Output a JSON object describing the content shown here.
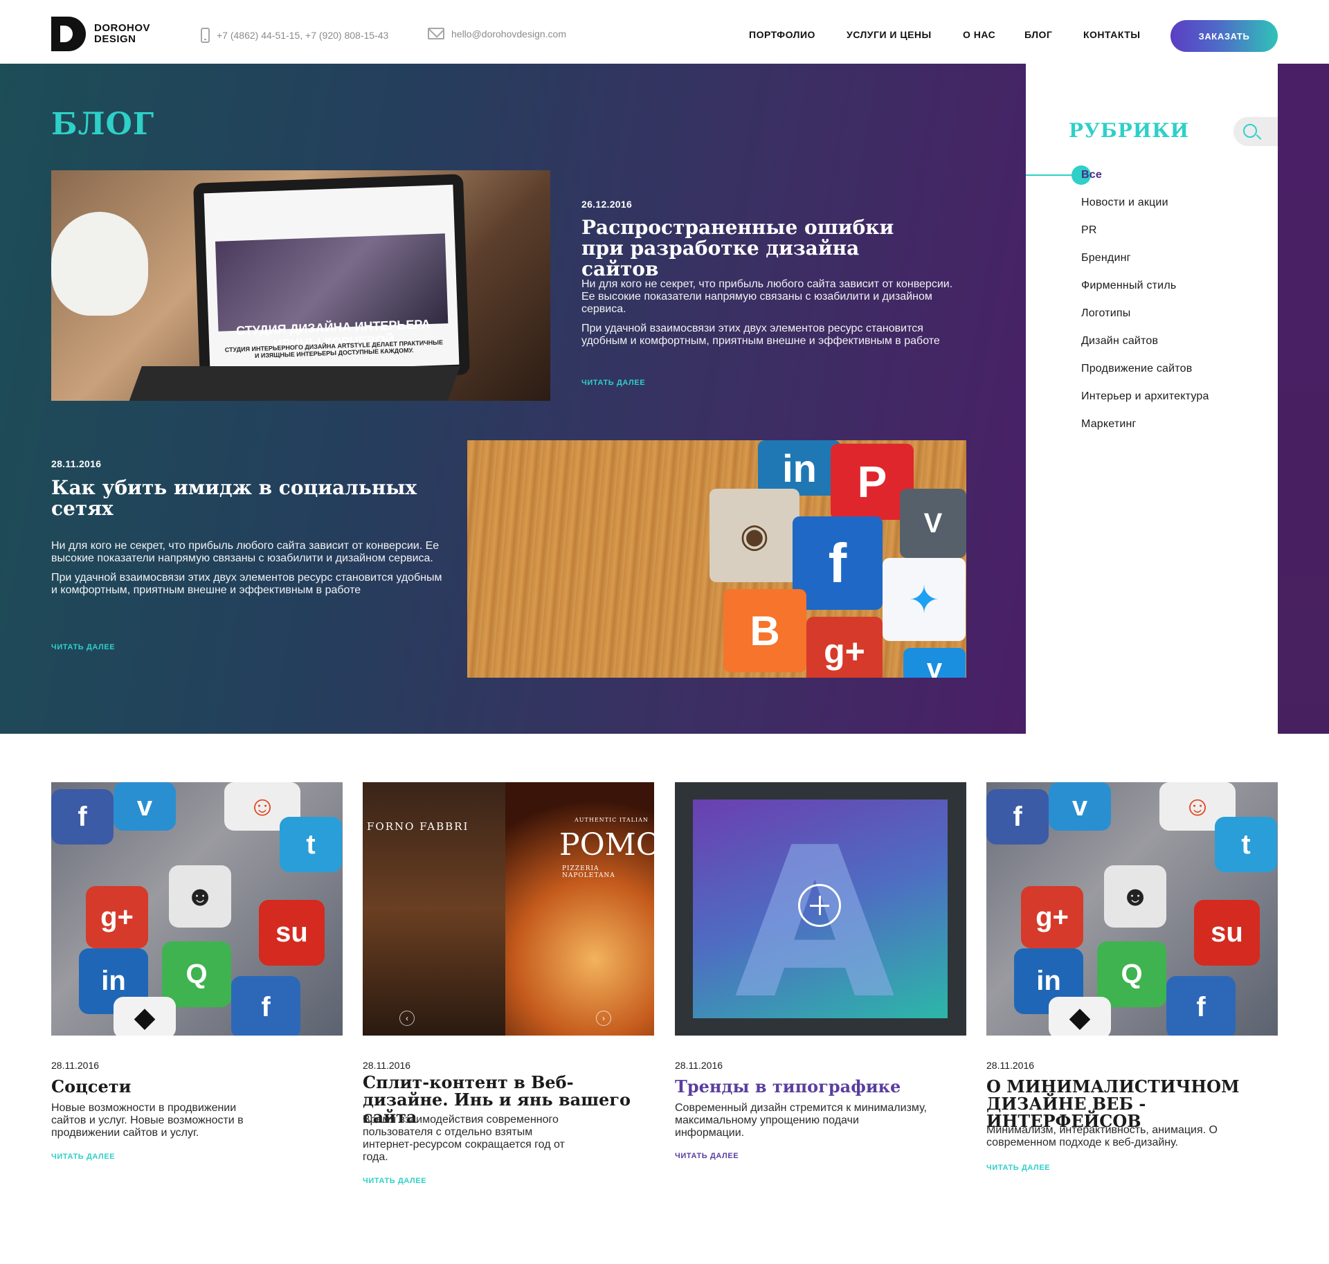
{
  "header": {
    "logo_line1": "DOROHOV",
    "logo_line2": "DESIGN",
    "phones": "+7 (4862) 44-51-15,  +7 (920) 808-15-43",
    "email": "hello@dorohovdesign.com",
    "nav": [
      "ПОРТФОЛИО",
      "УСЛУГИ И ЦЕНЫ",
      "О НАС",
      "БЛОГ",
      "КОНТАКТЫ"
    ],
    "order_label": "ЗАКАЗАТЬ"
  },
  "hero": {
    "title": "БЛОГ",
    "posts": [
      {
        "date": "26.12.2016",
        "title": "Распространенные ошибки при разработке дизайна сайтов",
        "p1": "Ни для кого не секрет, что прибыль любого сайта  зависит от конверсии. Ее высокие показатели напрямую связаны с юзабилити и дизайном сервиса.",
        "p2": "При удачной взаимосвязи этих двух элементов ресурс становится удобным и комфортным, приятным внешне и эффективным в работе",
        "more": "ЧИТАТЬ ДАЛЕЕ",
        "image_caption": "СТУДИЯ ДИЗАЙНА ИНТЕРЬЕРА ИРИНЫ КОРЧЕВОЙ",
        "image_subcaption": "СТУДИЯ ИНТЕРЬЕРНОГО ДИЗАЙНА ARTSTYLE ДЕЛАЕТ ПРАКТИЧНЫЕ И ИЗЯЩНЫЕ ИНТЕРЬЕРЫ ДОСТУПНЫЕ КАЖДОМУ."
      },
      {
        "date": "28.11.2016",
        "title": "Как убить имидж в социальных сетях",
        "p1": "Ни для кого не секрет, что прибыль любого сайта  зависит от конверсии. Ее высокие показатели напрямую связаны с юзабилити и дизайном сервиса.",
        "p2": "При удачной взаимосвязи этих двух элементов ресурс становится удобным и комфортным, приятным внешне и эффективным в работе",
        "more": "ЧИТАТЬ ДАЛЕЕ"
      }
    ]
  },
  "sidebar": {
    "title": "РУБРИКИ",
    "items": [
      "Все",
      "Новости и акции",
      "PR",
      "Брендинг",
      "Фирменный стиль",
      "Логотипы",
      "Дизайн сайтов",
      "Продвижение сайтов",
      "Интерьер и архитектура",
      "Маркетинг"
    ]
  },
  "cards": [
    {
      "date": "28.11.2016",
      "title": "Соцсети",
      "text": "Новые возможности в продвижении сайтов и услуг. Новые возможности в продвижении сайтов и услуг.",
      "more": "ЧИТАТЬ ДАЛЕЕ"
    },
    {
      "date": "28.11.2016",
      "title": "Сплит-контент в Веб-дизайне. Инь и янь вашего сайта",
      "text": "Время взаимодействия современного пользователя с отдельно взятым интернет-ресурсом сокращается год от года.",
      "more": "ЧИТАТЬ ДАЛЕЕ",
      "img_left": "FORNO FABBRI",
      "img_right": "POMO",
      "img_right_sub": "PIZZERIA NAPOLETANA",
      "img_right_top": "AUTHENTIC ITALIAN"
    },
    {
      "date": "28.11.2016",
      "title": "Тренды в типографике",
      "text": "Современный дизайн стремится к минимализму, максимальному упрощению подачи информации.",
      "more": "ЧИТАТЬ ДАЛЕЕ"
    },
    {
      "date": "28.11.2016",
      "title": "О МИНИМАЛИСТИЧНОМ ДИЗАЙНЕ ВЕБ - ИНТЕРФЕЙСОВ",
      "text": "Минимализм, интерактивность, анимация. О современном подходе к веб-дизайну.",
      "more": "ЧИТАТЬ ДАЛЕЕ"
    }
  ],
  "colors": {
    "accent_teal": "#2ed0c8",
    "accent_purple": "#5a3e9e",
    "hero_start": "#1d4d57",
    "hero_end": "#4a1f66"
  }
}
